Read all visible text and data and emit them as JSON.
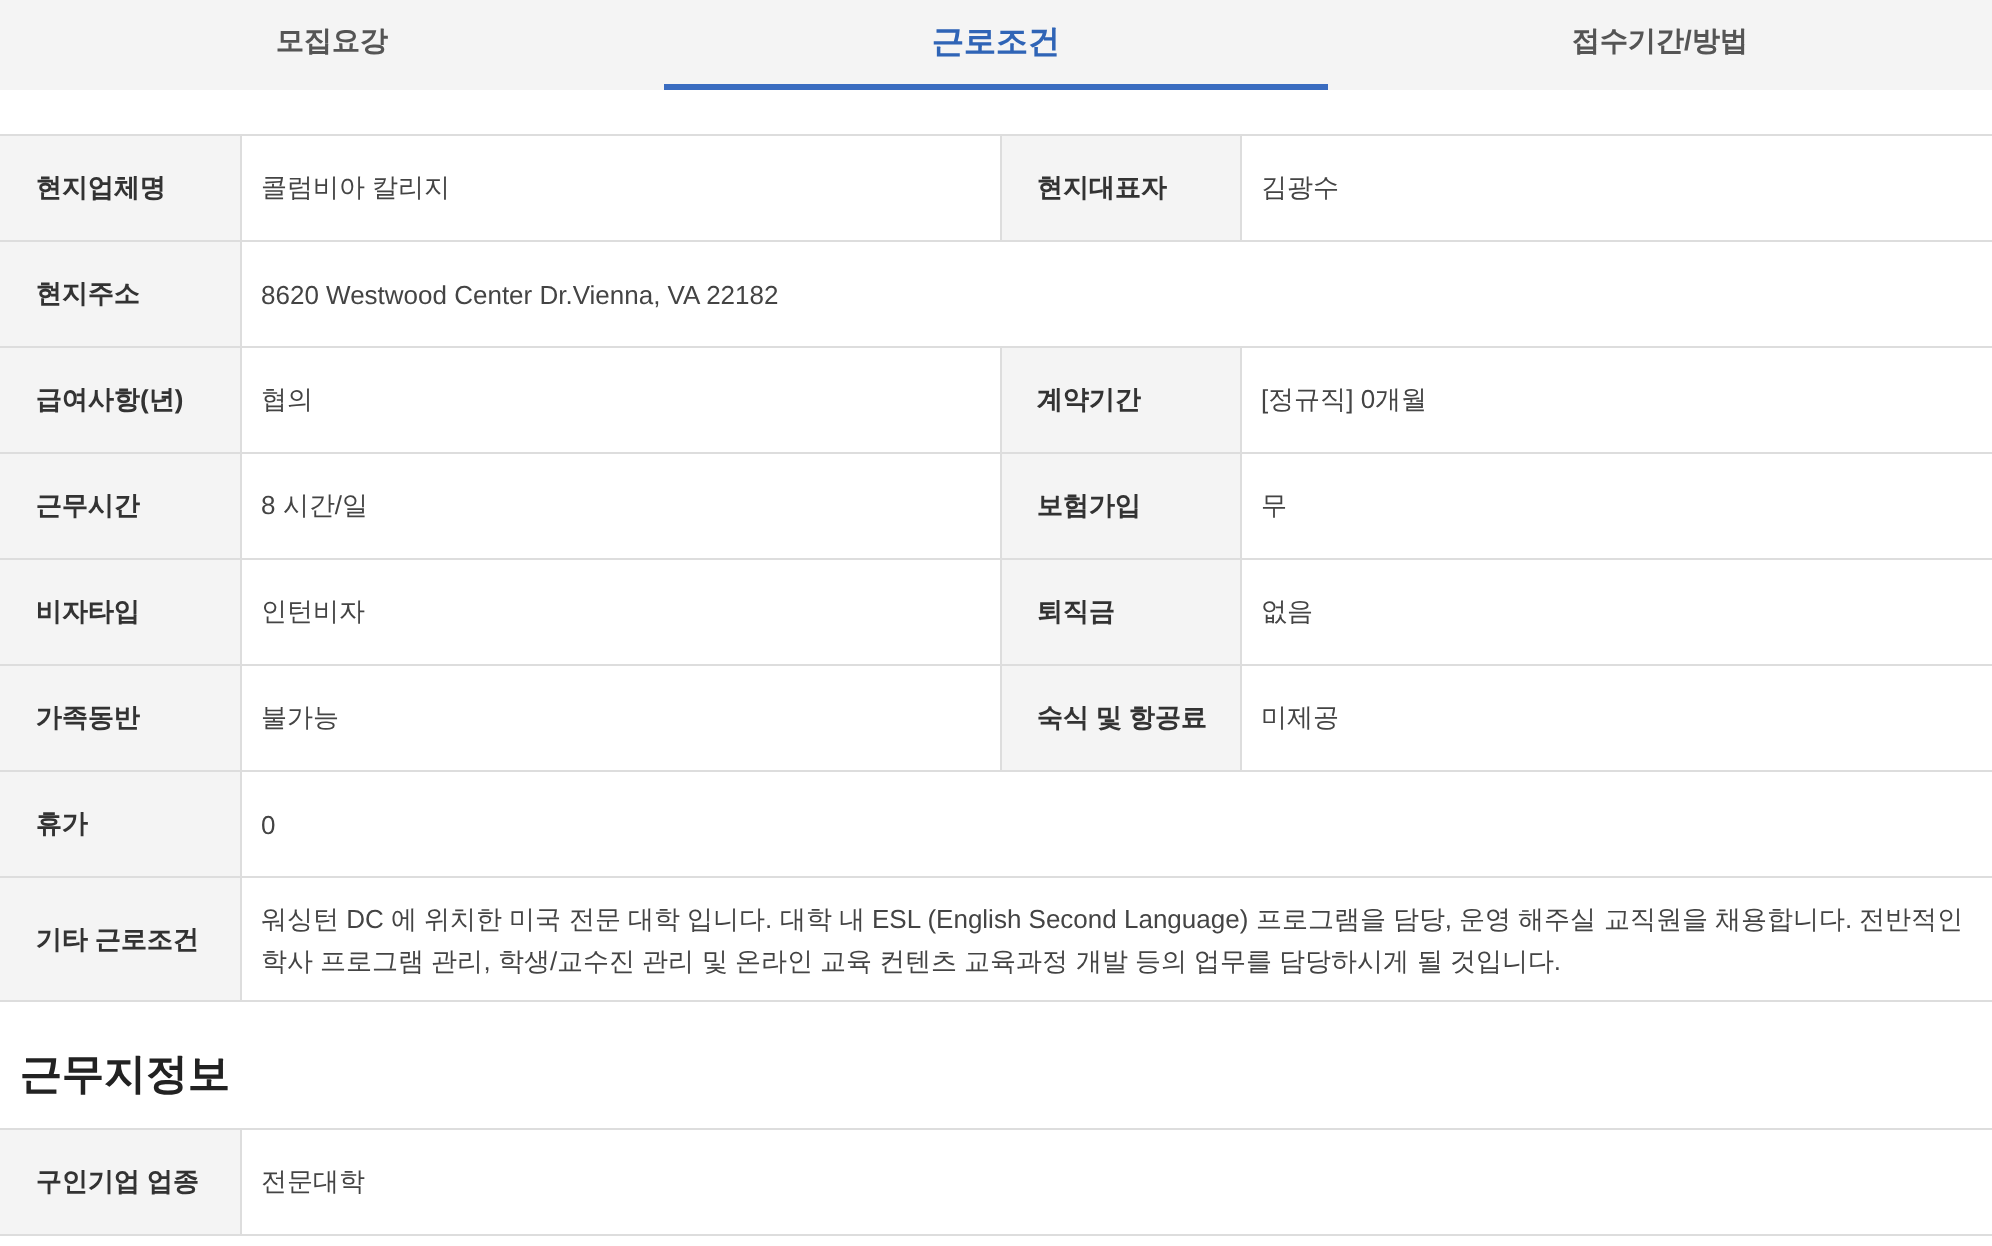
{
  "tabs": [
    {
      "label": "모집요강",
      "selected": false
    },
    {
      "label": "근로조건",
      "selected": true
    },
    {
      "label": "접수기간/방법",
      "selected": false
    }
  ],
  "conditions": [
    [
      {
        "label": "현지업체명",
        "value": "콜럼비아 칼리지"
      },
      {
        "label": "현지대표자",
        "value": "김광수"
      }
    ],
    [
      {
        "label": "현지주소",
        "value": "8620 Westwood Center Dr.Vienna, VA 22182"
      }
    ],
    [
      {
        "label": "급여사항(년)",
        "value": "협의"
      },
      {
        "label": "계약기간",
        "value": "[정규직] 0개월"
      }
    ],
    [
      {
        "label": "근무시간",
        "value": "8 시간/일"
      },
      {
        "label": "보험가입",
        "value": "무"
      }
    ],
    [
      {
        "label": "비자타입",
        "value": "인턴비자"
      },
      {
        "label": "퇴직금",
        "value": "없음"
      }
    ],
    [
      {
        "label": "가족동반",
        "value": "불가능"
      },
      {
        "label": "숙식 및 항공료",
        "value": "미제공"
      }
    ],
    [
      {
        "label": "휴가",
        "value": "0"
      }
    ],
    [
      {
        "label": "기타 근로조건",
        "value": "워싱턴 DC 에 위치한 미국 전문 대학 입니다. 대학 내 ESL (English Second Language) 프로그램을 담당, 운영 해주실 교직원을 채용합니다. 전반적인 학사 프로그램 관리, 학생/교수진 관리 및 온라인 교육 컨텐츠 교육과정 개발 등의 업무를 담당하시게 될 것입니다."
      }
    ]
  ],
  "workplace": {
    "title": "근무지정보",
    "rows": [
      [
        {
          "label": "구인기업 업종",
          "value": "전문대학"
        }
      ]
    ]
  }
}
